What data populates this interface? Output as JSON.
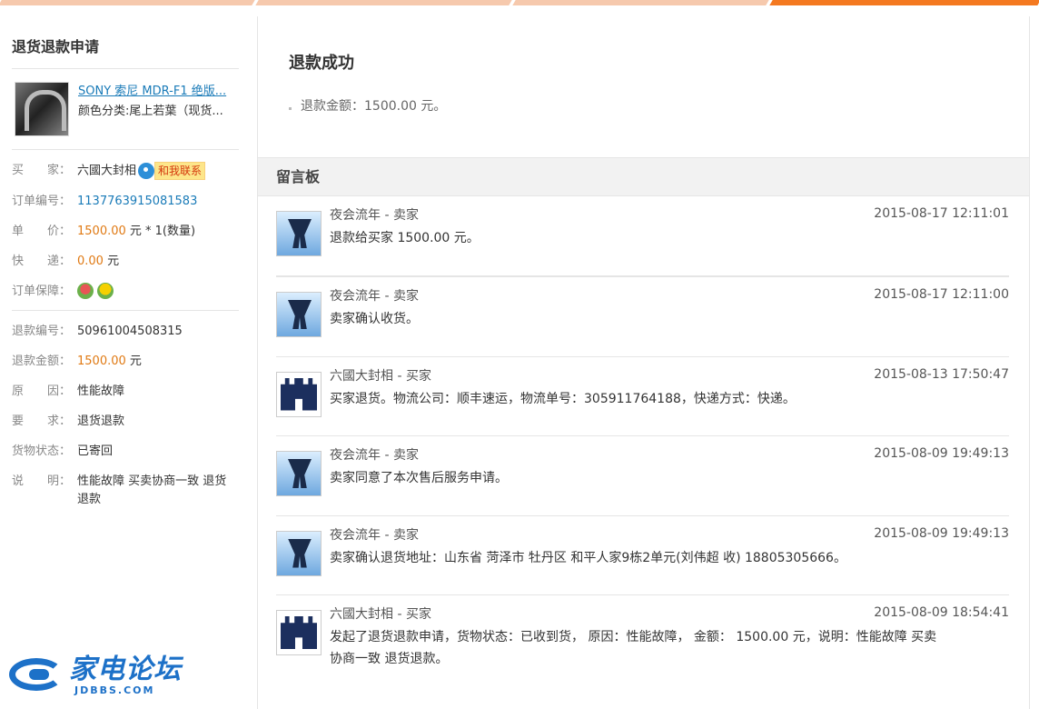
{
  "sidebar": {
    "title": "退货退款申请",
    "product": {
      "title": "SONY 索尼 MDR-F1 绝版...",
      "sku": "颜色分类:尾上若葉（现货..."
    },
    "buyer": {
      "label": "买　　家：",
      "name": "六國大封相",
      "contact_label": "和我联系"
    },
    "order_no": {
      "label": "订单编号：",
      "value": "1137763915081583"
    },
    "unit_price": {
      "label": "单　　价：",
      "value": "1500.00",
      "suffix": " 元 * 1(数量)"
    },
    "shipping": {
      "label": "快　　递：",
      "value": "0.00",
      "suffix": " 元"
    },
    "guarantee": {
      "label": "订单保障："
    },
    "refund_no": {
      "label": "退款编号：",
      "value": "50961004508315"
    },
    "refund_amount": {
      "label": "退款金额：",
      "value": "1500.00",
      "suffix": " 元"
    },
    "reason": {
      "label": "原　　因：",
      "value": "性能故障"
    },
    "request": {
      "label": "要　　求：",
      "value": "退货退款"
    },
    "goods_status": {
      "label": "货物状态：",
      "value": "已寄回"
    },
    "note": {
      "label": "说　　明：",
      "value": "性能故障 买卖协商一致 退货退款"
    }
  },
  "logo": {
    "cn": "家电论坛",
    "en": "JDBBS.COM"
  },
  "main": {
    "success_title": "退款成功",
    "amount_text": "退款金额：1500.00 元。",
    "board_title": "留言板",
    "messages": [
      {
        "author": "夜会流年 - 卖家",
        "time": "2015-08-17 12:11:01",
        "text": "退款给买家 1500.00 元。",
        "role": "seller"
      },
      {
        "author": "夜会流年 - 卖家",
        "time": "2015-08-17 12:11:00",
        "text": "卖家确认收货。",
        "role": "seller"
      },
      {
        "author": "六國大封相 - 买家",
        "time": "2015-08-13 17:50:47",
        "text": "买家退货。物流公司：顺丰速运，物流单号：305911764188，快递方式：快递。",
        "role": "buyer"
      },
      {
        "author": "夜会流年 - 卖家",
        "time": "2015-08-09 19:49:13",
        "text": "卖家同意了本次售后服务申请。",
        "role": "seller"
      },
      {
        "author": "夜会流年 - 卖家",
        "time": "2015-08-09 19:49:13",
        "text": "卖家确认退货地址：山东省 菏泽市 牡丹区 和平人家9栋2单元(刘伟超 收) 18805305666。",
        "role": "seller"
      },
      {
        "author": "六國大封相 - 买家",
        "time": "2015-08-09 18:54:41",
        "text": "发起了退货退款申请，货物状态：已收到货， 原因：性能故障， 金额： 1500.00 元，说明：性能故障 买卖协商一致 退货退款。",
        "role": "buyer"
      }
    ]
  },
  "colors": {
    "accent": "#f47920",
    "link": "#1a7bb8",
    "price": "#e07a14"
  }
}
